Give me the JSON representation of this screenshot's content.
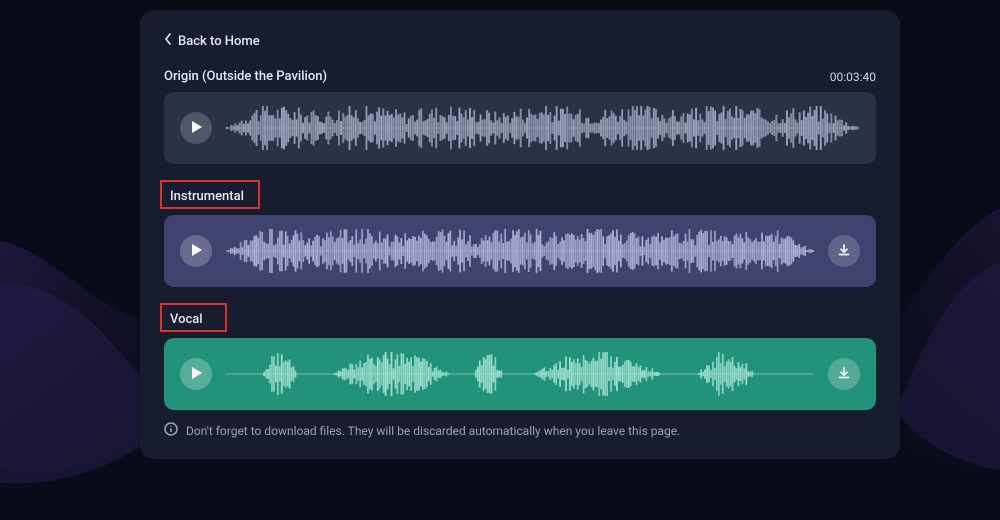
{
  "nav": {
    "back_label": "Back to Home"
  },
  "origin": {
    "title": "Origin (Outside the Pavilion)",
    "duration": "00:03:40"
  },
  "tracks": {
    "instrumental_label": "Instrumental",
    "vocal_label": "Vocal"
  },
  "footer": {
    "note": "Don't forget to download files. They will be discarded automatically when you leave this page."
  }
}
